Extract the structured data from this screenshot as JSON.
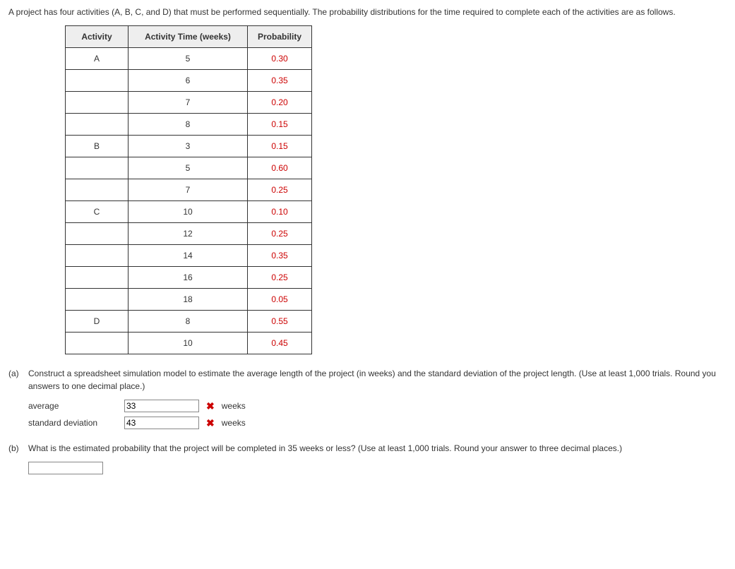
{
  "intro": "A project has four activities (A, B, C, and D) that must be performed sequentially. The probability distributions for the time required to complete each of the activities are as follows.",
  "table": {
    "headers": [
      "Activity",
      "Activity Time (weeks)",
      "Probability"
    ],
    "rows": [
      {
        "activity": "A",
        "time": "5",
        "prob": "0.30"
      },
      {
        "activity": "",
        "time": "6",
        "prob": "0.35"
      },
      {
        "activity": "",
        "time": "7",
        "prob": "0.20"
      },
      {
        "activity": "",
        "time": "8",
        "prob": "0.15"
      },
      {
        "activity": "B",
        "time": "3",
        "prob": "0.15"
      },
      {
        "activity": "",
        "time": "5",
        "prob": "0.60"
      },
      {
        "activity": "",
        "time": "7",
        "prob": "0.25"
      },
      {
        "activity": "C",
        "time": "10",
        "prob": "0.10"
      },
      {
        "activity": "",
        "time": "12",
        "prob": "0.25"
      },
      {
        "activity": "",
        "time": "14",
        "prob": "0.35"
      },
      {
        "activity": "",
        "time": "16",
        "prob": "0.25"
      },
      {
        "activity": "",
        "time": "18",
        "prob": "0.05"
      },
      {
        "activity": "D",
        "time": "8",
        "prob": "0.55"
      },
      {
        "activity": "",
        "time": "10",
        "prob": "0.45"
      }
    ]
  },
  "part_a": {
    "label": "(a)",
    "text": "Construct a spreadsheet simulation model to estimate the average length of the project (in weeks) and the standard deviation of the project length. (Use at least 1,000 trials. Round you answers to one decimal place.)",
    "average_label": "average",
    "average_value": "33",
    "stddev_label": "standard deviation",
    "stddev_value": "43",
    "unit": "weeks"
  },
  "part_b": {
    "label": "(b)",
    "text": "What is the estimated probability that the project will be completed in 35 weeks or less? (Use at least 1,000 trials. Round your answer to three decimal places.)",
    "value": ""
  }
}
